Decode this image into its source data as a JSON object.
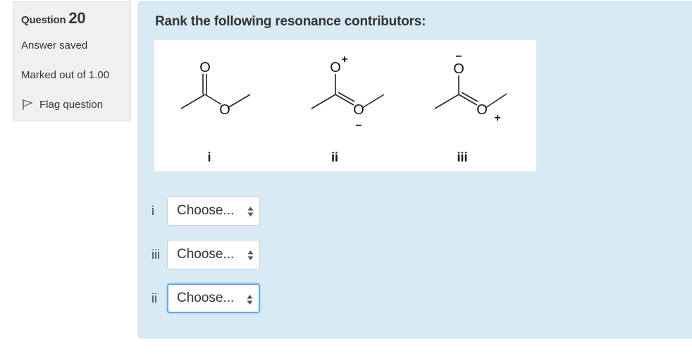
{
  "question": {
    "label": "Question",
    "number": "20",
    "status": "Answer saved",
    "marks": "Marked out of 1.00",
    "flag_label": "Flag question"
  },
  "prompt": "Rank the following resonance contributors:",
  "structures": [
    {
      "label": "i",
      "top_atom": "O",
      "ester_atom": "O",
      "top_charge": "",
      "ester_charge": ""
    },
    {
      "label": "ii",
      "top_atom": "O",
      "ester_atom": "O",
      "top_charge": "+",
      "ester_charge": "−"
    },
    {
      "label": "iii",
      "top_atom": "O",
      "ester_atom": "O",
      "top_charge": "−",
      "ester_charge": "+"
    }
  ],
  "answers": [
    {
      "label": "i",
      "value": "Choose..."
    },
    {
      "label": "iii",
      "value": "Choose..."
    },
    {
      "label": "ii",
      "value": "Choose..."
    }
  ],
  "colors": {
    "panel_bg": "#d8ebf4",
    "info_bg": "#f0f0f0",
    "focus": "#66a7e8"
  }
}
